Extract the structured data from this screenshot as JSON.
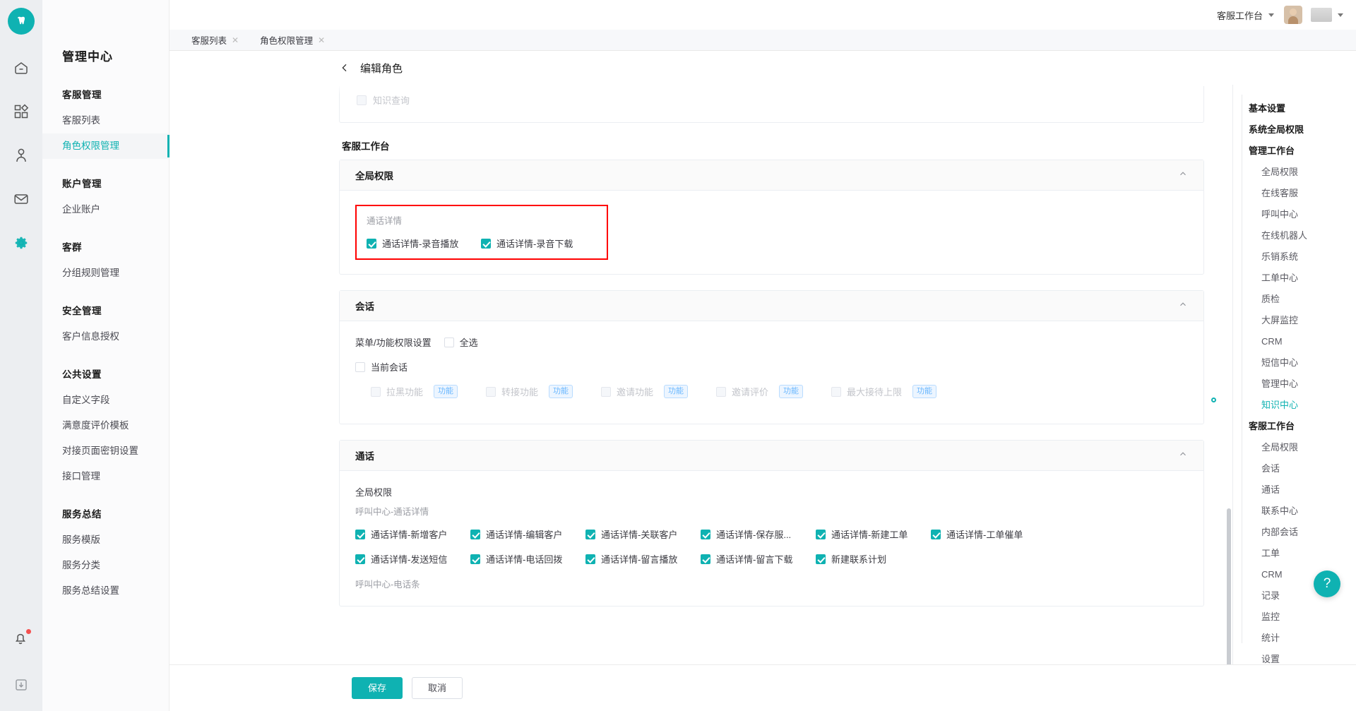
{
  "topbar": {
    "user_label": "客服工作台",
    "avatar_name": "user-avatar"
  },
  "tabs": [
    {
      "label": "客服列表",
      "close": "✕"
    },
    {
      "label": "角色权限管理",
      "close": "✕"
    }
  ],
  "sidebar": {
    "title": "管理中心",
    "groups": [
      {
        "title": "客服管理",
        "items": [
          {
            "label": "客服列表",
            "active": false
          },
          {
            "label": "角色权限管理",
            "active": true
          }
        ]
      },
      {
        "title": "账户管理",
        "items": [
          {
            "label": "企业账户",
            "active": false
          }
        ]
      },
      {
        "title": "客群",
        "items": [
          {
            "label": "分组规则管理",
            "active": false
          }
        ]
      },
      {
        "title": "安全管理",
        "items": [
          {
            "label": "客户信息授权",
            "active": false
          }
        ]
      },
      {
        "title": "公共设置",
        "items": [
          {
            "label": "自定义字段",
            "active": false
          },
          {
            "label": "满意度评价模板",
            "active": false
          },
          {
            "label": "对接页面密钥设置",
            "active": false
          },
          {
            "label": "接口管理",
            "active": false
          }
        ]
      },
      {
        "title": "服务总结",
        "items": [
          {
            "label": "服务模版",
            "active": false
          },
          {
            "label": "服务分类",
            "active": false
          },
          {
            "label": "服务总结设置",
            "active": false
          }
        ]
      }
    ]
  },
  "page": {
    "title": "编辑角色",
    "back_icon": "chevron-left-icon"
  },
  "top_partial_panel": {
    "checkbox": {
      "label": "知识查询",
      "checked": false,
      "disabled": true
    }
  },
  "workbench": {
    "section_label": "客服工作台",
    "cards": [
      {
        "title": "全局权限",
        "collapse_icon": "chevron-up-icon",
        "highlighted": true,
        "group_caption": "通话详情",
        "checkboxes": [
          {
            "label": "通话详情-录音播放",
            "checked": true,
            "disabled": false
          },
          {
            "label": "通话详情-录音下载",
            "checked": true,
            "disabled": false
          }
        ]
      },
      {
        "title": "会话",
        "collapse_icon": "chevron-up-icon",
        "menu_label": "菜单/功能权限设置",
        "select_all": {
          "label": "全选",
          "checked": false
        },
        "current_session": {
          "label": "当前会话",
          "checked": false
        },
        "features": [
          {
            "label": "拉黑功能",
            "tag": "功能",
            "checked": false,
            "disabled": true
          },
          {
            "label": "转接功能",
            "tag": "功能",
            "checked": false,
            "disabled": true
          },
          {
            "label": "邀请功能",
            "tag": "功能",
            "checked": false,
            "disabled": true
          },
          {
            "label": "邀请评价",
            "tag": "功能",
            "checked": false,
            "disabled": true
          },
          {
            "label": "最大接待上限",
            "tag": "功能",
            "checked": false,
            "disabled": true
          }
        ]
      },
      {
        "title": "通话",
        "collapse_icon": "chevron-up-icon",
        "global_label": "全局权限",
        "group_caption": "呼叫中心-通话详情",
        "row1": [
          {
            "label": "通话详情-新增客户",
            "checked": true
          },
          {
            "label": "通话详情-编辑客户",
            "checked": true
          },
          {
            "label": "通话详情-关联客户",
            "checked": true
          },
          {
            "label": "通话详情-保存服...",
            "checked": true
          },
          {
            "label": "通话详情-新建工单",
            "checked": true
          },
          {
            "label": "通话详情-工单催单",
            "checked": true
          }
        ],
        "row2": [
          {
            "label": "通话详情-发送短信",
            "checked": true
          },
          {
            "label": "通话详情-电话回拨",
            "checked": true
          },
          {
            "label": "通话详情-留言播放",
            "checked": true
          },
          {
            "label": "通话详情-留言下载",
            "checked": true
          },
          {
            "label": "新建联系计划",
            "checked": true
          }
        ],
        "group_caption2": "呼叫中心-电话条"
      }
    ]
  },
  "anchor_nav": {
    "items": [
      {
        "label": "基本设置",
        "level": 0,
        "active": false
      },
      {
        "label": "系统全局权限",
        "level": 0,
        "active": false
      },
      {
        "label": "管理工作台",
        "level": 0,
        "active": false
      },
      {
        "label": "全局权限",
        "level": 1,
        "active": false
      },
      {
        "label": "在线客服",
        "level": 1,
        "active": false
      },
      {
        "label": "呼叫中心",
        "level": 1,
        "active": false
      },
      {
        "label": "在线机器人",
        "level": 1,
        "active": false
      },
      {
        "label": "乐销系统",
        "level": 1,
        "active": false
      },
      {
        "label": "工单中心",
        "level": 1,
        "active": false
      },
      {
        "label": "质检",
        "level": 1,
        "active": false
      },
      {
        "label": "大屏监控",
        "level": 1,
        "active": false
      },
      {
        "label": "CRM",
        "level": 1,
        "active": false
      },
      {
        "label": "短信中心",
        "level": 1,
        "active": false
      },
      {
        "label": "管理中心",
        "level": 1,
        "active": false
      },
      {
        "label": "知识中心",
        "level": 1,
        "active": true
      },
      {
        "label": "客服工作台",
        "level": 0,
        "active": false
      },
      {
        "label": "全局权限",
        "level": 1,
        "active": false
      },
      {
        "label": "会话",
        "level": 1,
        "active": false
      },
      {
        "label": "通话",
        "level": 1,
        "active": false
      },
      {
        "label": "联系中心",
        "level": 1,
        "active": false
      },
      {
        "label": "内部会话",
        "level": 1,
        "active": false
      },
      {
        "label": "工单",
        "level": 1,
        "active": false
      },
      {
        "label": "CRM",
        "level": 1,
        "active": false
      },
      {
        "label": "记录",
        "level": 1,
        "active": false
      },
      {
        "label": "监控",
        "level": 1,
        "active": false
      },
      {
        "label": "统计",
        "level": 1,
        "active": false
      },
      {
        "label": "设置",
        "level": 1,
        "active": false
      }
    ]
  },
  "footer": {
    "save_label": "保存",
    "cancel_label": "取消"
  },
  "help_fab": {
    "icon": "question-mark-icon",
    "label": "?"
  },
  "colors": {
    "accent": "#0fb2b2",
    "highlight_border": "#ff0000",
    "tag_text": "#69b7ff",
    "notify_dot": "#f5504f"
  }
}
